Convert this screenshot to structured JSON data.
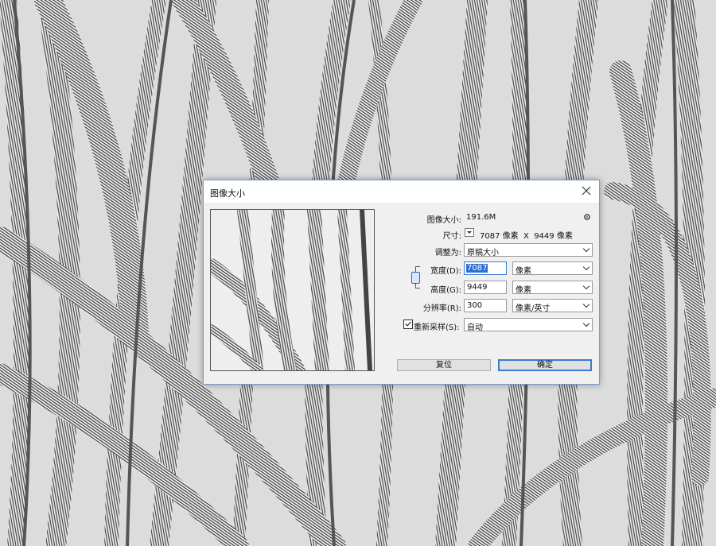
{
  "dialog": {
    "title": "图像大小",
    "image_size_label": "图像大小:",
    "image_size_value": "191.6M",
    "dimensions_label": "尺寸:",
    "dimensions_value": "7087 像素  X  9449 像素",
    "fit_to_label": "调整为:",
    "fit_to_value": "原稿大小",
    "width_label": "宽度(D):",
    "width_value": "7087",
    "width_unit": "像素",
    "height_label": "高度(G):",
    "height_value": "9449",
    "height_unit": "像素",
    "resolution_label": "分辨率(R):",
    "resolution_value": "300",
    "resolution_unit": "像素/英寸",
    "resample_label": "重新采样(S):",
    "resample_checked": true,
    "resample_value": "自动",
    "reset_button": "复位",
    "ok_button": "确定"
  },
  "icons": {
    "close": "close-icon",
    "gear": "gear-icon",
    "link": "chain-link-icon"
  },
  "colors": {
    "dialog_bg": "#f0f0f0",
    "accent": "#2f6fd1",
    "background": "#d9d9d9"
  }
}
